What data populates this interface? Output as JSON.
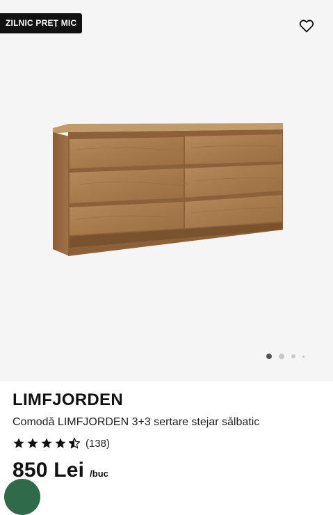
{
  "gallery": {
    "badge": "ZILNIC PREȚ MIC",
    "favorite_icon": "heart-outline-icon",
    "slide_count": 4,
    "active_slide": 1
  },
  "product": {
    "name": "LIMFJORDEN",
    "description": "Comodă LIMFJORDEN 3+3 sertare stejar sălbatic",
    "rating": 4.5,
    "review_count": "(138)",
    "price": "850 Lei",
    "unit": "/buc"
  },
  "colors": {
    "badge_bg": "#111111",
    "gallery_bg": "#f5f5f5",
    "chat_bubble": "#2f6b4a"
  }
}
